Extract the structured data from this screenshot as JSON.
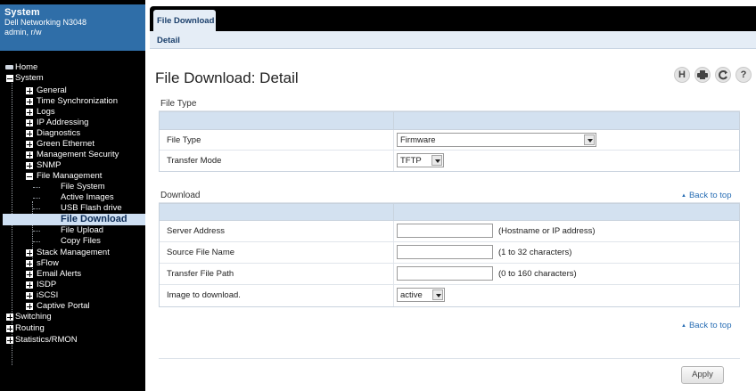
{
  "system_header": {
    "title": "System",
    "model": "Dell Networking N3048",
    "user": "admin, r/w"
  },
  "tree": {
    "home": "Home",
    "system": "System",
    "general": "General",
    "time_sync": "Time Synchronization",
    "logs": "Logs",
    "ip_addressing": "IP Addressing",
    "diagnostics": "Diagnostics",
    "green_ethernet": "Green Ethernet",
    "mgmt_security": "Management Security",
    "snmp": "SNMP",
    "file_management": "File Management",
    "file_system": "File System",
    "active_images": "Active Images",
    "usb_flash": "USB Flash drive",
    "file_download": "File Download",
    "file_upload": "File Upload",
    "copy_files": "Copy Files",
    "stack_management": "Stack Management",
    "sflow": "sFlow",
    "email_alerts": "Email Alerts",
    "isdp": "ISDP",
    "iscsi": "iSCSI",
    "captive_portal": "Captive Portal",
    "switching": "Switching",
    "routing": "Routing",
    "statistics": "Statistics/RMON"
  },
  "tabs": {
    "active": "File Download",
    "subtab": "Detail"
  },
  "page": {
    "title": "File Download: Detail"
  },
  "toolbar": {
    "help": "?"
  },
  "file_type_section": {
    "title": "File Type",
    "rows": [
      {
        "label": "File Type",
        "value": "Firmware"
      },
      {
        "label": "Transfer Mode",
        "value": "TFTP"
      }
    ]
  },
  "download_section": {
    "title": "Download",
    "back_to_top": "Back to top",
    "rows": [
      {
        "label": "Server Address",
        "value": "",
        "hint": "(Hostname or IP address)"
      },
      {
        "label": "Source File Name",
        "value": "",
        "hint": "(1 to 32 characters)"
      },
      {
        "label": "Transfer File Path",
        "value": "",
        "hint": "(0 to 160 characters)"
      },
      {
        "label": "Image to download.",
        "value": "active"
      }
    ],
    "back_to_top_bottom": "Back to top"
  },
  "apply_label": "Apply"
}
